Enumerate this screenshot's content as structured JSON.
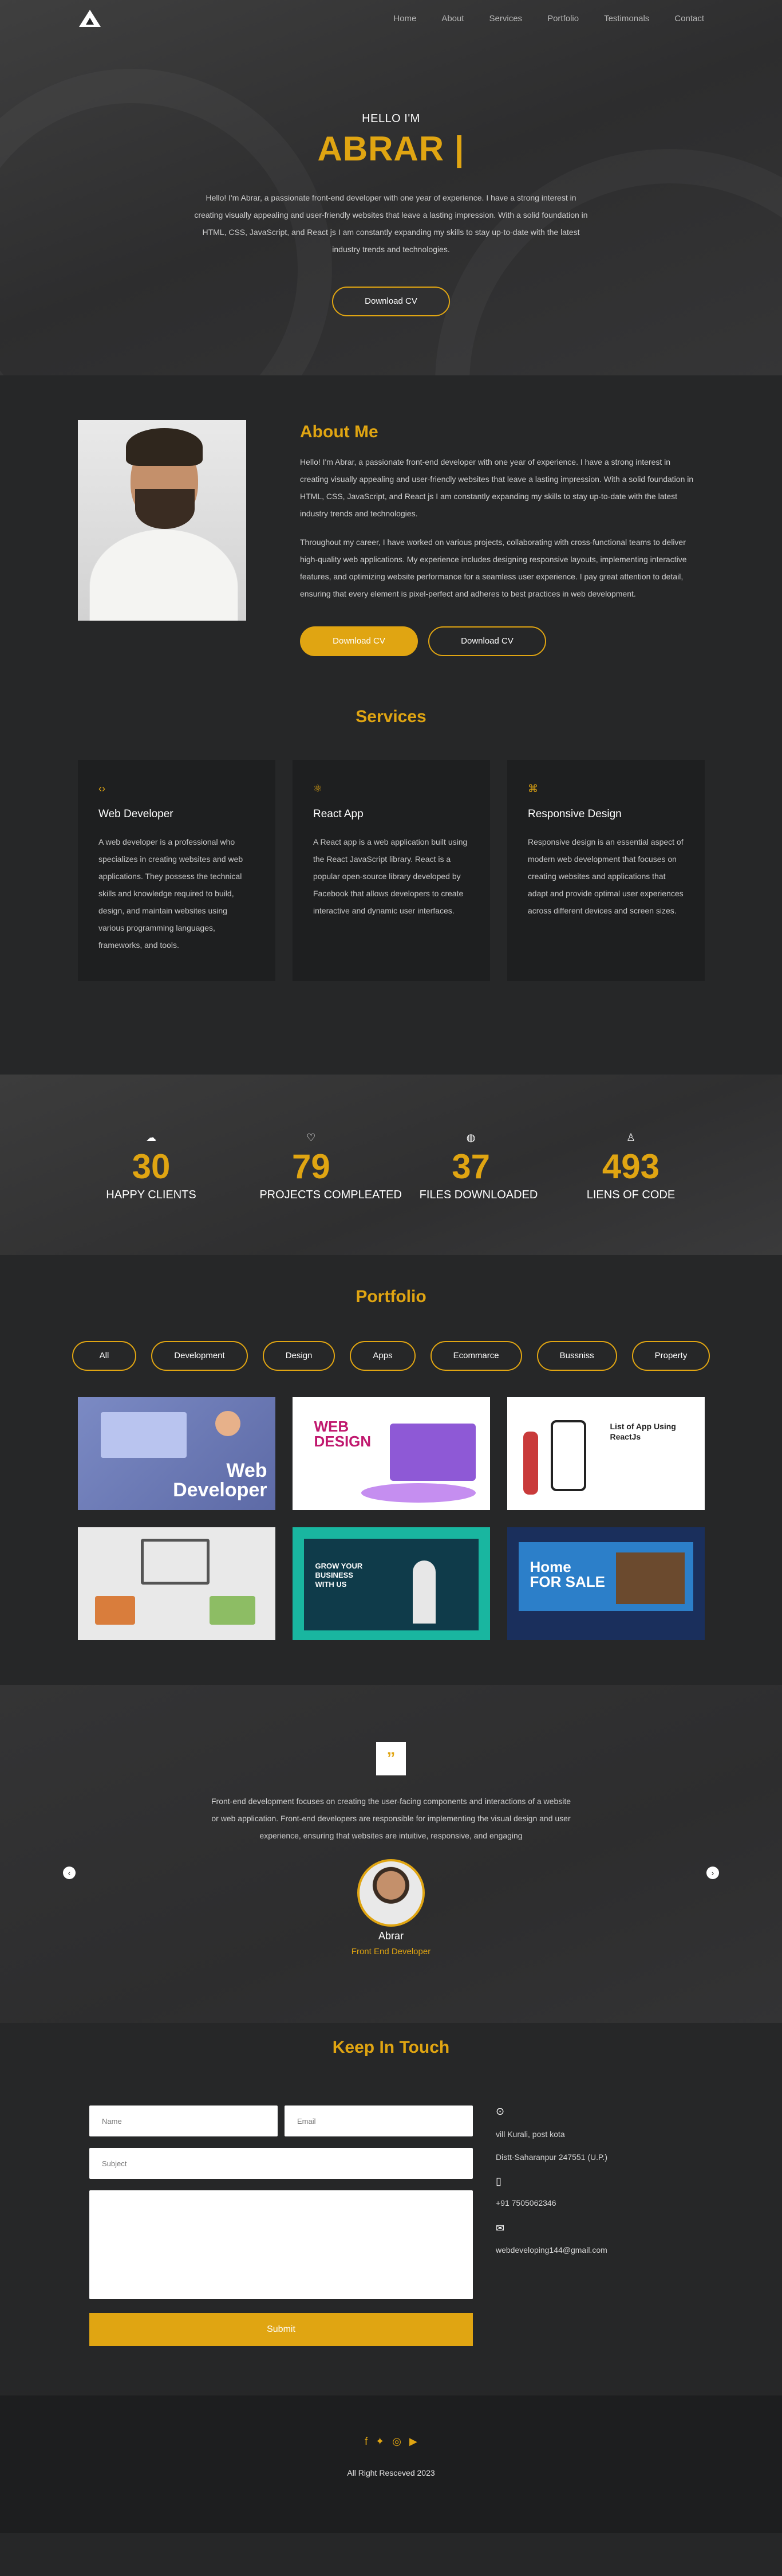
{
  "nav": {
    "logo": "logo-icon",
    "links": [
      "Home",
      "About",
      "Services",
      "Portfolio",
      "Testimonals",
      "Contact"
    ]
  },
  "hero": {
    "hello": "HELLO I'M",
    "name": "ABRAR |",
    "text": "Hello! I'm Abrar, a passionate front-end developer with one year of experience. I have a strong interest in creating visually appealing and user-friendly websites that leave a lasting impression. With a solid foundation in HTML, CSS, JavaScript, and React js I am constantly expanding my skills to stay up-to-date with the latest industry trends and technologies.",
    "button": "Download CV"
  },
  "about": {
    "title": "About Me",
    "p1": "Hello! I'm Abrar, a passionate front-end developer with one year of experience. I have a strong interest in creating visually appealing and user-friendly websites that leave a lasting impression. With a solid foundation in HTML, CSS, JavaScript, and React js I am constantly expanding my skills to stay up-to-date with the latest industry trends and technologies.",
    "p2": "Throughout my career, I have worked on various projects, collaborating with cross-functional teams to deliver high-quality web applications. My experience includes designing responsive layouts, implementing interactive features, and optimizing website performance for a seamless user experience. I pay great attention to detail, ensuring that every element is pixel-perfect and adheres to best practices in web development.",
    "btn1": "Download CV",
    "btn2": "Download CV"
  },
  "services": {
    "title": "Services",
    "cards": [
      {
        "icon": "code-icon",
        "glyph": "‹›",
        "title": "Web Developer",
        "text": "A web developer is a professional who specializes in creating websites and web applications. They possess the technical skills and knowledge required to build, design, and maintain websites using various programming languages, frameworks, and tools."
      },
      {
        "icon": "react-icon",
        "glyph": "⚛",
        "title": "React App",
        "text": "A React app is a web application built using the React JavaScript library. React is a popular open-source library developed by Facebook that allows developers to create interactive and dynamic user interfaces."
      },
      {
        "icon": "responsive-icon",
        "glyph": "⌘",
        "title": "Responsive Design",
        "text": "Responsive design is an essential aspect of modern web development that focuses on creating websites and applications that adapt and provide optimal user experiences across different devices and screen sizes."
      }
    ]
  },
  "stats": [
    {
      "icon": "cloud-icon",
      "glyph": "☁",
      "value": "30",
      "label": "HAPPY CLIENTS"
    },
    {
      "icon": "heart-icon",
      "glyph": "♡",
      "value": "79",
      "label": "PROJECTS COMPLEATED"
    },
    {
      "icon": "globe-icon",
      "glyph": "◍",
      "value": "37",
      "label": "FILES DOWNLOADED"
    },
    {
      "icon": "user-icon",
      "glyph": "♙",
      "value": "493",
      "label": "LIENS OF CODE"
    }
  ],
  "portfolio": {
    "title": "Portfolio",
    "filters": [
      "All",
      "Development",
      "Design",
      "Apps",
      "Ecommarce",
      "Bussniss",
      "Property"
    ],
    "tiles": [
      {
        "text": "Web\nDeveloper",
        "bg": "#6a79b5"
      },
      {
        "text": "WEB\nDESIGN",
        "bg": "#ffffff"
      },
      {
        "text": "List of App Using\nReactJs",
        "bg": "#ffffff"
      },
      {
        "text": "",
        "bg": "#e8e8e8"
      },
      {
        "text": "GROW YOUR\nBUSINESS\nWITH US",
        "bg": "#19b6a0"
      },
      {
        "text": "Home\nFOR SALE",
        "bg": "#1a2f5c"
      }
    ]
  },
  "testimonial": {
    "quote": "”",
    "text": "Front-end development focuses on creating the user-facing components and interactions of a website or web application. Front-end developers are responsible for implementing the visual design and user experience, ensuring that websites are intuitive, responsive, and engaging",
    "name": "Abrar",
    "role": "Front End Developer",
    "prev": "‹",
    "next": "›"
  },
  "contact": {
    "title": "Keep In Touch",
    "name_ph": "Name",
    "email_ph": "Email",
    "subject_ph": "Subject",
    "submit": "Submit",
    "address1": "vill Kurali, post kota",
    "address2": "Distt-Saharanpur 247551 (U.P.)",
    "phone": "+91 7505062346",
    "email": "webdeveloping144@gmail.com"
  },
  "footer": {
    "copyright": "All Right Resceved 2023",
    "socials": [
      "facebook-icon",
      "twitter-icon",
      "instagram-icon",
      "youtube-icon"
    ]
  },
  "colors": {
    "accent": "#e0a512",
    "background": "#262728",
    "card": "#1e1f20"
  }
}
